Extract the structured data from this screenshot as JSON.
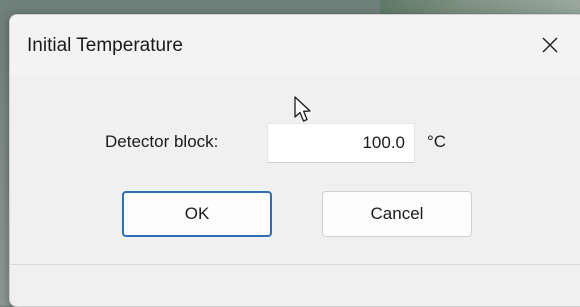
{
  "dialog": {
    "title": "Initial Temperature",
    "close_icon": "close-icon",
    "field": {
      "label": "Detector block:",
      "value": "100.0",
      "unit": "°C"
    },
    "buttons": {
      "ok_label": "OK",
      "cancel_label": "Cancel"
    }
  },
  "pointer": "arrow-cursor-icon",
  "colors": {
    "dialog_bg": "#f0f0f0",
    "default_button_border": "#2f6fb6"
  }
}
